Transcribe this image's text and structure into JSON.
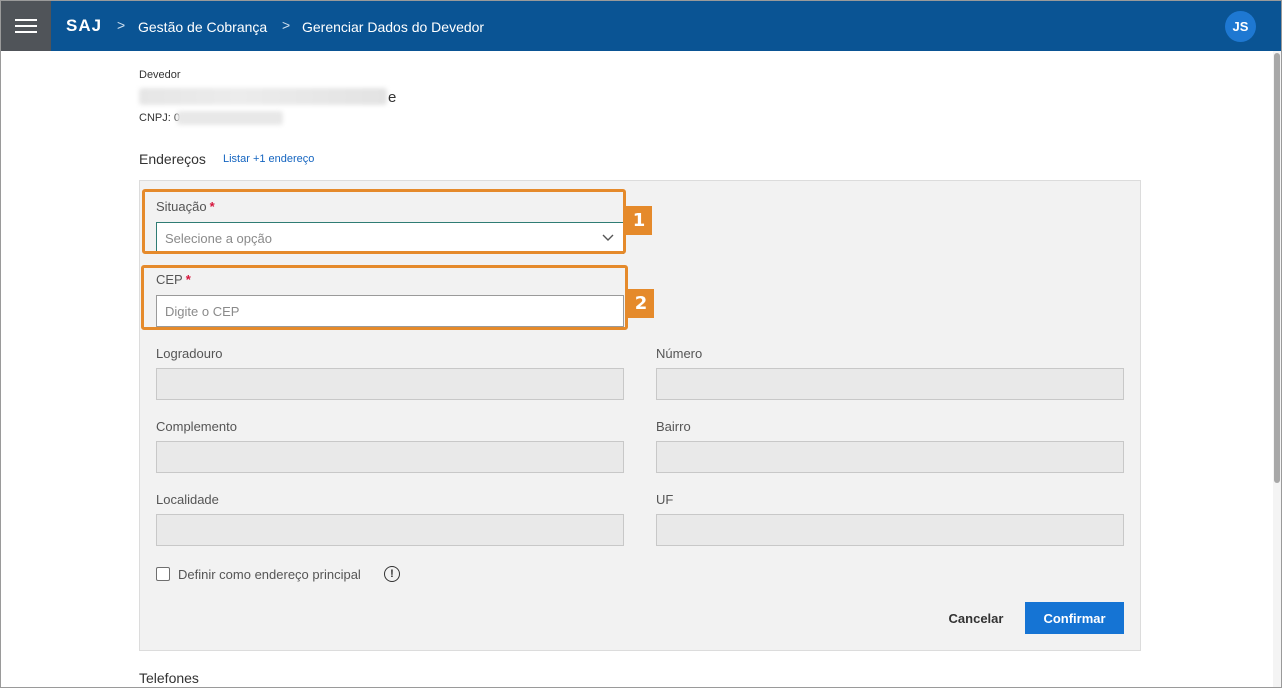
{
  "header": {
    "menu_icon": "hamburger-menu-icon",
    "brand": "SAJ",
    "breadcrumb": [
      "Gestão de Cobrança",
      "Gerenciar Dados do Devedor"
    ],
    "separator": ">",
    "avatar_initials": "JS",
    "colors": {
      "bar": "#0a5494",
      "menu_bg": "#505459",
      "avatar": "#1e78d2"
    }
  },
  "debtor": {
    "label": "Devedor",
    "name_visible_tail": "e",
    "cnpj_label": "CNPJ: 0"
  },
  "addresses": {
    "title": "Endereços",
    "list_link": "Listar +1 endereço",
    "fields": {
      "situacao": {
        "label": "Situação",
        "required_mark": "*",
        "placeholder": "Selecione a opção"
      },
      "cep": {
        "label": "CEP",
        "required_mark": "*",
        "placeholder": "Digite o CEP"
      },
      "logradouro": {
        "label": "Logradouro"
      },
      "numero": {
        "label": "Número"
      },
      "complemento": {
        "label": "Complemento"
      },
      "bairro": {
        "label": "Bairro"
      },
      "localidade": {
        "label": "Localidade"
      },
      "uf": {
        "label": "UF"
      }
    },
    "main_address_checkbox": {
      "label": "Definir como endereço principal",
      "checked": false,
      "info_icon": "info-circle-icon"
    },
    "cancel_label": "Cancelar",
    "confirm_label": "Confirmar",
    "callouts": [
      "1",
      "2"
    ],
    "colors": {
      "callout": "#e58a2b",
      "confirm": "#1574d4",
      "required": "#d6143b"
    }
  },
  "phones": {
    "title": "Telefones"
  }
}
